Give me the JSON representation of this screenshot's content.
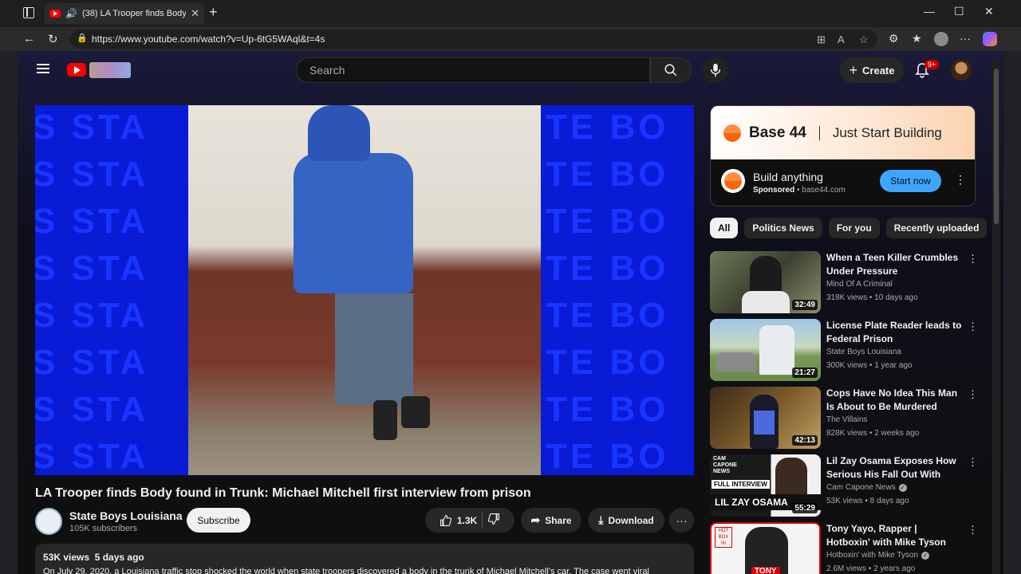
{
  "browser": {
    "tab_title": "(38) LA Trooper finds Body f",
    "url": "https://www.youtube.com/watch?v=Up-6tG5WAql&t=4s"
  },
  "masthead": {
    "search_placeholder": "Search",
    "create_label": "Create",
    "notification_count": "9+"
  },
  "player": {
    "bg_rows": [
      "S  STA",
      "S  STA",
      "S  STA",
      "S  STA",
      "S  STA",
      "S  STA",
      "S  STA",
      "S  STA"
    ],
    "bg_rows_right": [
      "TE BO",
      "TE BO",
      "TE BO",
      "TE BO",
      "TE BO",
      "TE BO",
      "TE BO",
      "TE BO"
    ]
  },
  "video": {
    "title": "LA Trooper finds Body found in Trunk: Michael Mitchell first interview from prison",
    "channel_name": "State Boys Louisiana",
    "subscribers": "105K subscribers",
    "subscribe_label": "Subscribe",
    "likes": "1.3K",
    "share_label": "Share",
    "download_label": "Download",
    "views": "53K views",
    "age": "5 days ago",
    "description": "On July 29, 2020, a Louisiana traffic stop shocked the world when state troopers discovered a body in the trunk of Michael Mitchell's car. The case went viral"
  },
  "ad": {
    "brand": "Base 44",
    "tagline": "Just Start Building",
    "headline": "Build anything",
    "sponsored": "Sponsored",
    "domain": "base44.com",
    "cta": "Start now"
  },
  "chips": [
    "All",
    "Politics News",
    "For you",
    "Recently uploaded"
  ],
  "recommendations": [
    {
      "title": "When a Teen Killer Crumbles Under Pressure",
      "channel": "Mind Of A Criminal",
      "meta": "318K views • 10 days ago",
      "duration": "32:49",
      "verified": false
    },
    {
      "title": "License Plate Reader leads to Federal Prison",
      "channel": "State Boys Louisiana",
      "meta": "300K views • 1 year ago",
      "duration": "21:27",
      "verified": false
    },
    {
      "title": "Cops Have No Idea This Man Is About to Be Murdered",
      "channel": "The Villains",
      "meta": "828K views • 2 weeks ago",
      "duration": "42:13",
      "verified": false
    },
    {
      "title": "Lil Zay Osama Exposes How Serious His Fall Out With king ...",
      "channel": "Cam Capone News",
      "meta": "53K views • 8 days ago",
      "duration": "55:29",
      "verified": true
    },
    {
      "title": "Tony Yayo, Rapper | Hotboxin' with Mike Tyson",
      "channel": "Hotboxin' with Mike Tyson",
      "meta": "2.6M views • 2 years ago",
      "duration": "",
      "verified": true
    }
  ],
  "thumb_labels": {
    "full_interview": "FULL INTERVIEW",
    "lil_zay": "LIL ZAY OSAMA",
    "cam_capone": "CAM CAPONE NEWS",
    "tony": "TONY"
  },
  "colors": {
    "accent_red": "#ff0000",
    "player_blue": "#0a1bd6",
    "cta_blue": "#3ea6ff"
  }
}
